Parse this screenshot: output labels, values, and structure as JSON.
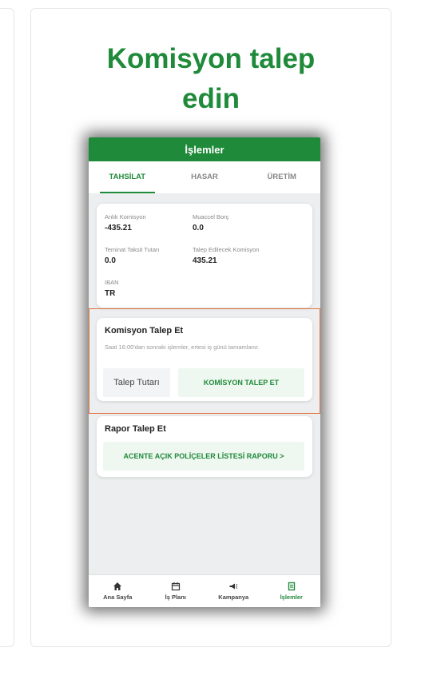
{
  "headline": {
    "line1": "Komisyon talep",
    "line2": "edin"
  },
  "colors": {
    "brand_green": "#1f8a3a",
    "highlight_orange": "#e4753f"
  },
  "appbar": {
    "title": "İşlemler"
  },
  "tabs": [
    {
      "label": "TAHSİLAT",
      "active": true
    },
    {
      "label": "HASAR",
      "active": false
    },
    {
      "label": "ÜRETİM",
      "active": false
    }
  ],
  "info": {
    "anlik_label": "Anlık Komisyon",
    "anlik_value": "-435.21",
    "muaccel_label": "Muaccel Borç",
    "muaccel_value": "0.0",
    "teminat_label": "Teminat Taksit Tutarı",
    "teminat_value": "0.0",
    "talep_label": "Talep Edilecek Komisyon",
    "talep_value": "435.21",
    "iban_label": "IBAN",
    "iban_value": "TR"
  },
  "komisyon": {
    "title": "Komisyon Talep Et",
    "note": "Saat 16:00'dan sonraki işlemler, ertesi iş günü tamamlanır.",
    "input_placeholder": "Talep Tutarı",
    "button_label": "KOMİSYON TALEP ET"
  },
  "rapor": {
    "title": "Rapor Talep Et",
    "button_label": "ACENTE AÇIK POLİÇELER LİSTESİ RAPORU  >"
  },
  "bottom_nav": [
    {
      "label": "Ana Sayfa",
      "icon": "home-icon",
      "active": false
    },
    {
      "label": "İş Planı",
      "icon": "calendar-icon",
      "active": false
    },
    {
      "label": "Kampanya",
      "icon": "megaphone-icon",
      "active": false
    },
    {
      "label": "İşlemler",
      "icon": "document-icon",
      "active": true
    }
  ]
}
